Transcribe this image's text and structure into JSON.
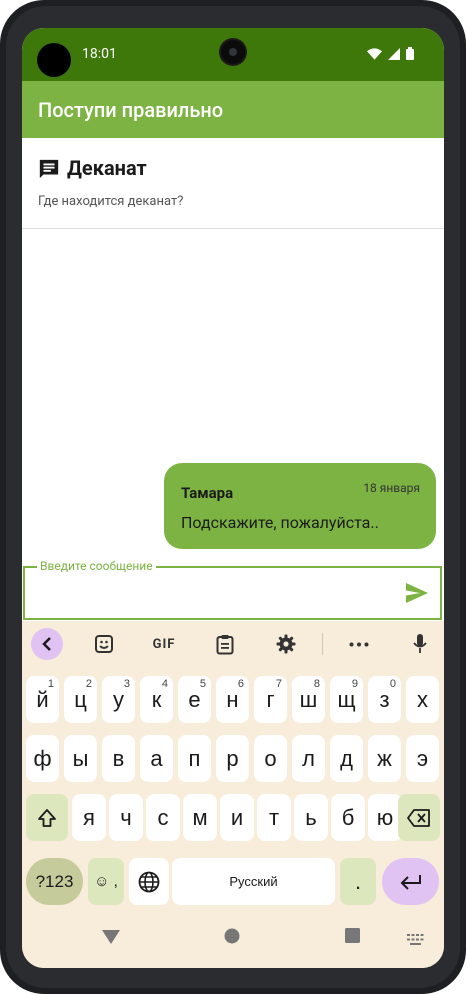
{
  "status": {
    "time": "18:01"
  },
  "app": {
    "title": "Поступи правильно"
  },
  "topic": {
    "title": "Деканат",
    "subtitle": "Где находится деканат?"
  },
  "message": {
    "author": "Тамара",
    "date": "18 января",
    "text": "Подскажите, пожалуйста.."
  },
  "input": {
    "label": "Введите сообщение",
    "value": ""
  },
  "keyboard": {
    "toolbar": {
      "gif": "GIF"
    },
    "row1": [
      {
        "k": "й",
        "n": "1"
      },
      {
        "k": "ц",
        "n": "2"
      },
      {
        "k": "у",
        "n": "3"
      },
      {
        "k": "к",
        "n": "4"
      },
      {
        "k": "е",
        "n": "5"
      },
      {
        "k": "н",
        "n": "6"
      },
      {
        "k": "г",
        "n": "7"
      },
      {
        "k": "ш",
        "n": "8"
      },
      {
        "k": "щ",
        "n": "9"
      },
      {
        "k": "з",
        "n": "0"
      },
      {
        "k": "х",
        "n": ""
      }
    ],
    "row2": [
      "ф",
      "ы",
      "в",
      "а",
      "п",
      "р",
      "о",
      "л",
      "д",
      "ж",
      "э"
    ],
    "row3": [
      "я",
      "ч",
      "с",
      "м",
      "и",
      "т",
      "ь",
      "б",
      "ю"
    ],
    "symbols": "?123",
    "space": "Русский",
    "period": ".",
    "emoji_comma": "☺ ,"
  },
  "colors": {
    "statusbar": "#3f780a",
    "appbar": "#7cb342",
    "bubble": "#7cb342",
    "keyboard_bg": "#f8ecda",
    "accent": "#7cb342"
  }
}
